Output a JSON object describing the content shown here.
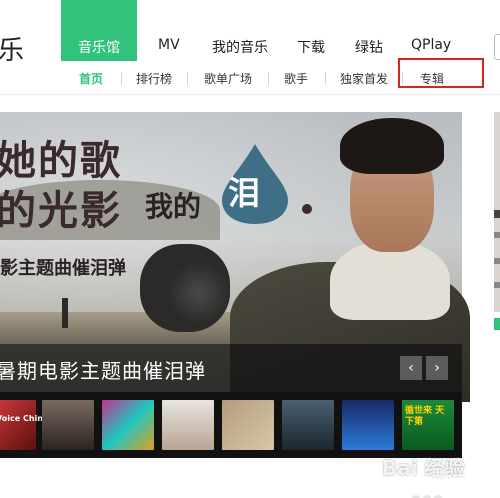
{
  "header": {
    "logo_fragment": "乐",
    "tabs": [
      {
        "label": "音乐馆",
        "active": true
      },
      {
        "label": "MV"
      },
      {
        "label": "我的音乐"
      },
      {
        "label": "下载"
      },
      {
        "label": "绿钻"
      },
      {
        "label": "QPlay"
      }
    ]
  },
  "subnav": {
    "items": [
      {
        "label": "首页",
        "active": true
      },
      {
        "label": "排行榜"
      },
      {
        "label": "歌单广场"
      },
      {
        "label": "歌手"
      },
      {
        "label": "独家首发"
      },
      {
        "label": "专辑",
        "highlighted": true
      }
    ]
  },
  "banner": {
    "title_line1": "她的歌",
    "title_line2": "的光影",
    "title_sub": "我的",
    "title_drop": "泪",
    "title_line3": "影主题曲催泪弹",
    "caption": "暑期电影主题曲催泪弹",
    "prev_icon": "‹",
    "next_icon": "›"
  },
  "thumbnails": [
    {
      "name": "voice-china",
      "text": "Voice China"
    },
    {
      "name": "singer-1"
    },
    {
      "name": "singer-2"
    },
    {
      "name": "singer-3"
    },
    {
      "name": "singer-4"
    },
    {
      "name": "singer-5"
    },
    {
      "name": "singer-6"
    },
    {
      "name": "album-promo",
      "text": "循世来 天下第"
    }
  ],
  "watermark": {
    "main": "Bai 经验",
    "sub": "jingyan.baidu.com"
  },
  "colors": {
    "brand_green": "#31c27c",
    "highlight_red": "#d9231f"
  }
}
